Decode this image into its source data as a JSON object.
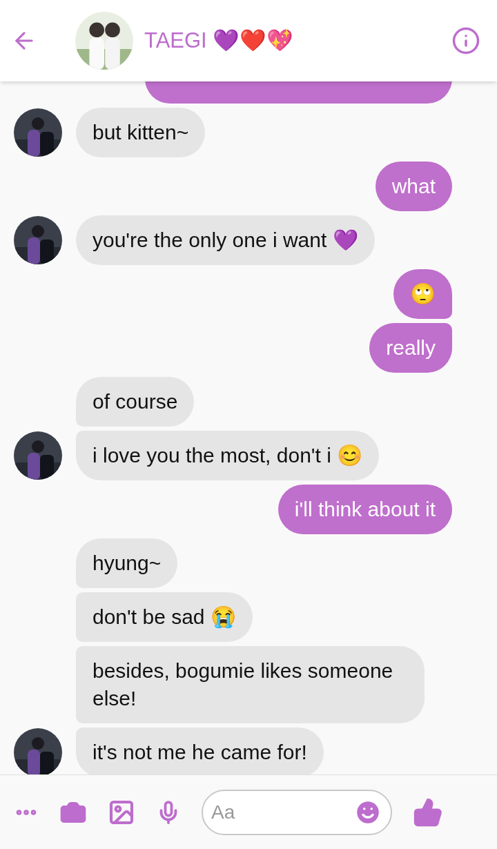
{
  "header": {
    "title": "TAEGI 💜❤️💖"
  },
  "messages": [
    {
      "kind": "partial"
    },
    {
      "kind": "received",
      "text": "but kitten~"
    },
    {
      "kind": "sent",
      "text": "what"
    },
    {
      "kind": "received",
      "text": "you're the only one i want 💜"
    },
    {
      "kind": "sent",
      "text": "🙄"
    },
    {
      "kind": "sent",
      "text": "really"
    },
    {
      "kind": "received",
      "text": "of course"
    },
    {
      "kind": "received",
      "text": "i love you the most, don't i 😊"
    },
    {
      "kind": "sent",
      "text": "i'll think about it"
    },
    {
      "kind": "received",
      "text": "hyung~"
    },
    {
      "kind": "received",
      "text": "don't be sad 😭"
    },
    {
      "kind": "received",
      "text": "besides, bogumie likes someone else!"
    },
    {
      "kind": "received",
      "text": "it's not me he came for!"
    }
  ],
  "composer": {
    "placeholder": "Aa"
  }
}
